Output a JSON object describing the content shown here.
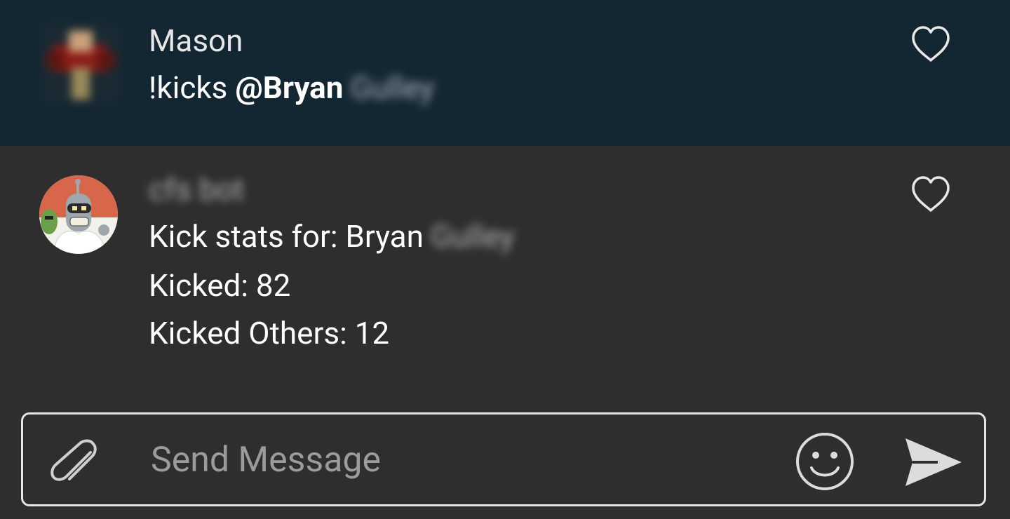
{
  "messages": [
    {
      "sender": "Mason",
      "text_prefix": "!kicks ",
      "mention": "@Bryan",
      "mention_suffix_obscured": "Gulley"
    },
    {
      "sender_obscured": "cfs bot",
      "lines": [
        {
          "prefix": "Kick stats for: Bryan",
          "obscured": "Gulley"
        },
        {
          "text": "Kicked: 82"
        },
        {
          "text": "Kicked Others: 12"
        }
      ]
    }
  ],
  "composer": {
    "placeholder": "Send Message"
  },
  "colors": {
    "highlight_bg": "#132733",
    "bg": "#2e2e2e",
    "text": "#ffffff",
    "placeholder": "#9b9b9b"
  },
  "icons": {
    "like": "heart-outline-icon",
    "attach": "paperclip-icon",
    "emoji": "smiley-icon",
    "send": "send-icon"
  }
}
